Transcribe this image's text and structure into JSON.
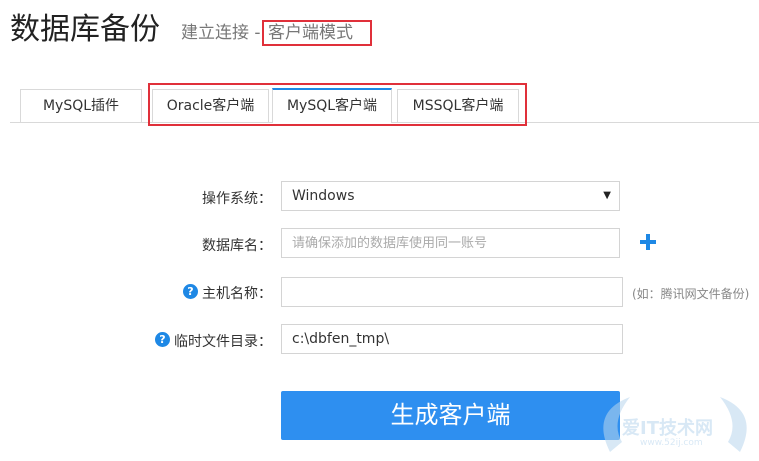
{
  "header": {
    "title": "数据库备份",
    "subtitle": "建立连接 -",
    "mode": "客户端模式"
  },
  "tabs": [
    {
      "label": "MySQL插件"
    },
    {
      "label": "Oracle客户端"
    },
    {
      "label": "MySQL客户端",
      "active": true
    },
    {
      "label": "MSSQL客户端"
    }
  ],
  "form": {
    "os": {
      "label": "操作系统：",
      "value": "Windows"
    },
    "db_name": {
      "label": "数据库名：",
      "placeholder": "请确保添加的数据库使用同一账号"
    },
    "host": {
      "label": "主机名称：",
      "value": "",
      "hint": "(如：腾讯网文件备份)"
    },
    "tmp_dir": {
      "label": "临时文件目录：",
      "value": "c:\\dbfen_tmp\\"
    }
  },
  "buttons": {
    "generate": "生成客户端"
  },
  "watermark": {
    "text": "爱IT技术网",
    "sub": "www.52ij.com"
  },
  "colors": {
    "accent": "#1e88e5",
    "highlight_border": "#e0303a",
    "button": "#2e8ff0"
  },
  "icons": {
    "help": "question-circle-icon",
    "add": "plus-icon",
    "select": "caret-down-icon"
  }
}
